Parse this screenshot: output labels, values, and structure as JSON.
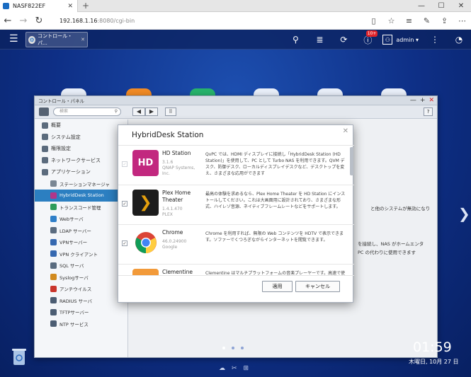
{
  "browser": {
    "tab_title": "NASF822EF",
    "tab_close": "✕",
    "new_tab": "+",
    "window_buttons": [
      "—",
      "☐",
      "✕"
    ],
    "back": "←",
    "forward": "→",
    "reload": "↻",
    "address_host": "192.168.1.16",
    "address_path": ":8080/cgi-bin",
    "toolbar_icons": [
      "reading-view-icon",
      "favorite-star-icon",
      "hub-icon",
      "note-icon",
      "share-icon",
      "more-icon"
    ],
    "toolbar_glyphs": [
      "▯",
      "☆",
      "≡",
      "✎",
      "⇪",
      "⋯"
    ]
  },
  "qts": {
    "menu_glyph": "☰",
    "task_tab_label": "コントロール・パ...",
    "task_tab_close": "✕",
    "icons": [
      "search-icon",
      "stack-icon",
      "sync-icon",
      "info-icon"
    ],
    "icon_glyphs": [
      "⚲",
      "≣",
      "⟳",
      "ⓘ"
    ],
    "notification_badge": "10+",
    "user": "admin ▾",
    "more": "⋮",
    "dashboard": "◔"
  },
  "control_panel": {
    "title": "コントロール・パネル",
    "window_buttons": [
      "—",
      "+",
      "✕"
    ],
    "search_placeholder": "検索",
    "nav_back": "◀",
    "nav_forward": "▶",
    "apps_glyph": "⠿",
    "help": "?",
    "sidebar": [
      {
        "label": "概要",
        "level": "top",
        "color": "#5b6b7d"
      },
      {
        "label": "システム設定",
        "level": "top",
        "color": "#5b6b7d"
      },
      {
        "label": "権限設定",
        "level": "top",
        "color": "#5b6b7d"
      },
      {
        "label": "ネットワークサービス",
        "level": "top",
        "color": "#5b6b7d"
      },
      {
        "label": "アプリケーション",
        "level": "top",
        "color": "#5b6b7d"
      },
      {
        "label": "ステーションマネージャ",
        "level": "sub",
        "color": "#7a8794"
      },
      {
        "label": "HybridDesk Station",
        "level": "sub",
        "color": "#b0368a",
        "active": true
      },
      {
        "label": "トランスコード管理",
        "level": "sub",
        "color": "#2e9c5a"
      },
      {
        "label": "Webサーバ",
        "level": "sub",
        "color": "#2f7fc8"
      },
      {
        "label": "LDAP サーバー",
        "level": "sub",
        "color": "#5a6c80"
      },
      {
        "label": "VPNサーバー",
        "level": "sub",
        "color": "#3568b0"
      },
      {
        "label": "VPN クライアント",
        "level": "sub",
        "color": "#3568b0"
      },
      {
        "label": "SQL サーバ",
        "level": "sub",
        "color": "#5a6c80"
      },
      {
        "label": "Syslogサーバ",
        "level": "sub",
        "color": "#d18a1f"
      },
      {
        "label": "アンチウイルス",
        "level": "sub",
        "color": "#c9352c"
      },
      {
        "label": "RADIUS サーバ",
        "level": "sub",
        "color": "#4b5d73"
      },
      {
        "label": "TFTPサーバー",
        "level": "sub",
        "color": "#4b5d73"
      },
      {
        "label": "NTP サービス",
        "level": "sub",
        "color": "#4b5d73"
      }
    ],
    "content_text": [
      "と他のシステムが無効になり",
      "を接続し、NAS がホームエンタ",
      "PC の代わりに使用できます"
    ]
  },
  "modal": {
    "title": "HybridDesk Station",
    "close": "✕",
    "apps": [
      {
        "name": "HD Station",
        "version": "3.1.6",
        "vendor": "QNAP Systems, Inc.",
        "description": "QvPC では、HDMI ディスプレイに接続し「HybridDesk Station (HD Station)」を使用して、PC として Turbo NAS を利用できます。QVM デスク、防御デスク、ローカルディスプレイデスクなど、デスクトップを変え、さまざまな応用ができます",
        "checked": true,
        "disabled": true,
        "logo_text": "HD",
        "logo_color": "#c2287f"
      },
      {
        "name": "Plex Home Theater",
        "version": "1.4.1.470",
        "vendor": "PLEX",
        "description": "最高の体験を求めるなら、Plex Home Theater を HD Station にインストールしてください。これは大画面用に設計されており、さまざまな形式、ハイレゾ音源、ネイティブフレームレートなどをサポートします。",
        "checked": true,
        "disabled": false,
        "logo_text": "❯",
        "logo_color": "#1d1d1d"
      },
      {
        "name": "Chrome",
        "version": "46.0.24900",
        "vendor": "Google",
        "description": "Chrome を利用すれば、無限の Web コンテンツを HDTV で表示できます。ソファーでくつろぎながらインターネットを閲覧できます。",
        "checked": true,
        "disabled": false,
        "logo_text": "",
        "logo_color": "#ffffff"
      },
      {
        "name": "Clementine",
        "version": "",
        "vendor": "",
        "description": "Clementine はマルチプラットフォームの音楽プレーヤーです。高速で使い勝手の良いインターフェイスでインターネットラジオを聞いたり、Turbo",
        "checked": true,
        "disabled": false,
        "logo_text": "",
        "logo_color": "#f29a3a"
      }
    ],
    "apply_label": "適用",
    "cancel_label": "キャンセル"
  },
  "desktop": {
    "clock": "01:59",
    "date": "木曜日, 10月 27 日",
    "page_dots": 3,
    "active_dot": 0,
    "bottom_icons": [
      "cloud-icon",
      "tools-icon",
      "media-icon"
    ],
    "bottom_glyphs": [
      "☁",
      "✂",
      "⊞"
    ],
    "right_arrow": "❯"
  }
}
